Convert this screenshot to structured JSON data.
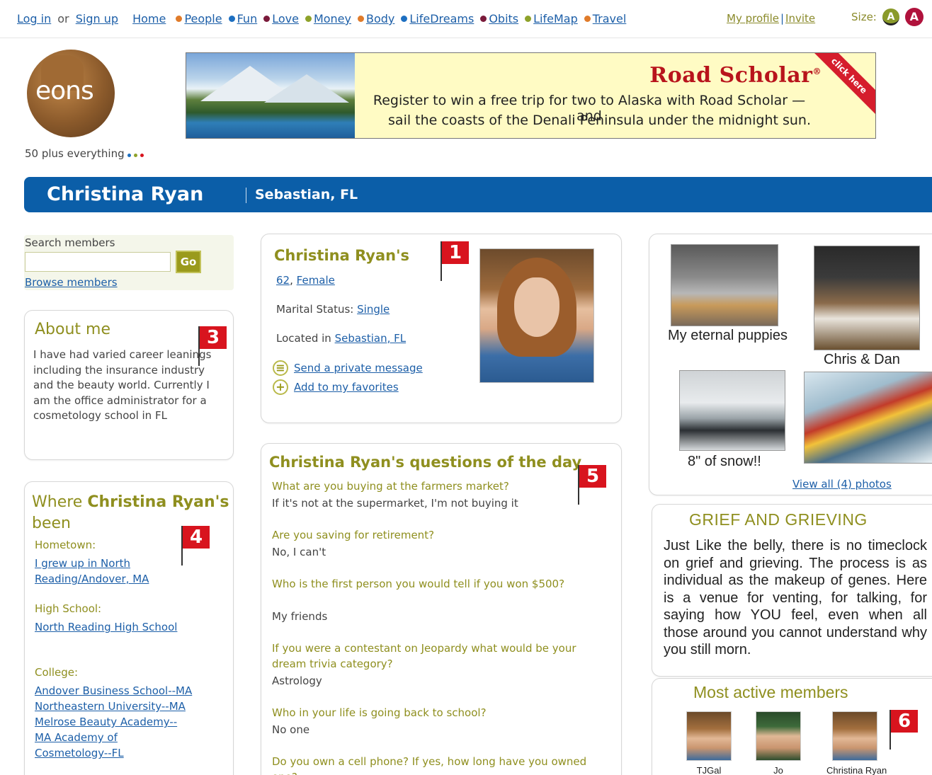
{
  "nav": {
    "login": "Log in",
    "or": "or",
    "signup": "Sign up",
    "home": "Home",
    "items": [
      {
        "label": "People",
        "color": "#e07b2a"
      },
      {
        "label": "Fun",
        "color": "#1d6fc1"
      },
      {
        "label": "Love",
        "color": "#7a1a3a"
      },
      {
        "label": "Money",
        "color": "#8ea22a"
      },
      {
        "label": "Body",
        "color": "#e07b2a"
      },
      {
        "label": "LifeDreams",
        "color": "#1d6fc1"
      },
      {
        "label": "Obits",
        "color": "#7a1a3a"
      },
      {
        "label": "LifeMap",
        "color": "#8ea22a"
      },
      {
        "label": "Travel",
        "color": "#e07b2a"
      }
    ],
    "my_profile": "My profile",
    "separator": "|",
    "invite": "Invite",
    "size_label": "Size:",
    "size_small": "A",
    "size_large": "A"
  },
  "header": {
    "logo_text": "eons",
    "tagline": "50 plus everything",
    "tagline_dot_colors": [
      "#1d6fc1",
      "#8ea22a",
      "#d8141e"
    ]
  },
  "banner": {
    "brand": "Road Scholar",
    "brand_mark": "®",
    "ribbon": "click here",
    "line1": "Register to win a free trip for two to Alaska with Road Scholar — and",
    "line2": "sail the coasts of the Denali Peninsula under the midnight sun."
  },
  "namebar": {
    "name": "Christina Ryan",
    "location": "Sebastian, FL",
    "color": "#0b5ea8"
  },
  "search": {
    "label": "Search members",
    "placeholder": "",
    "go": "Go",
    "browse": "Browse members"
  },
  "about": {
    "title": "About me",
    "text": "I have had varied career leanings including the insurance industry and the beauty world. Currently I am the office administrator for a cosmetology school in FL"
  },
  "where": {
    "title_prefix": "Where",
    "title_name": "Christina Ryan's",
    "title_suffix": "been",
    "hometown_label": "Hometown:",
    "hometown": [
      "I grew up in North",
      "Reading/Andover, MA"
    ],
    "highschool_label": "High School:",
    "highschool": "North Reading High School",
    "college_label": "College:",
    "colleges": [
      "Andover Business School--MA",
      "Northeastern University--MA",
      "Melrose Beauty Academy--",
      "MA Academy of",
      "Cosmetology--FL"
    ]
  },
  "card": {
    "title": "Christina Ryan's",
    "age": "62",
    "comma": ",",
    "sex": "Female",
    "marital_label": "Marital Status:",
    "marital": "Single",
    "located_label": "Located in",
    "located": "Sebastian, FL",
    "message": "Send a private message",
    "favorites": "Add to my favorites",
    "message_icon": "message-icon",
    "favorites_icon": "plus-circle-icon"
  },
  "questions": {
    "title_name": "Christina Ryan's",
    "title_rest": "questions of the day",
    "items": [
      {
        "q": "What are you buying at the farmers market?",
        "a": "If it's not at the supermarket, I'm not buying it"
      },
      {
        "q": "Are you saving for retirement?",
        "a": "No, I can't"
      },
      {
        "q": "Who is the first person you would tell if you won $500?",
        "a": "My friends"
      },
      {
        "q": "If you were a contestant on Jeopardy what would be your dream trivia category?",
        "a": "Astrology"
      },
      {
        "q": "Who in your life is going back to school?",
        "a": "No one"
      },
      {
        "q": "Do you own a cell phone? If yes, how long have you owned one?",
        "a": ""
      }
    ]
  },
  "photos": {
    "captions": [
      "My eternal puppies",
      "Chris & Dan",
      "8\" of snow!!",
      ""
    ],
    "view_all": "View all (4) photos"
  },
  "grief": {
    "title": "GRIEF AND GRIEVING",
    "text": "Just Like the belly, there is no timeclock on grief and grieving. The process is as individual as the makeup of genes. Here is a venue for venting, for talking, for saying how YOU feel, even when all those around you cannot understand why you still morn."
  },
  "active": {
    "title": "Most active members",
    "members": [
      "TJGal",
      "Jo",
      "Christina Ryan"
    ]
  },
  "flags": [
    "1",
    "3",
    "4",
    "5",
    "6"
  ]
}
